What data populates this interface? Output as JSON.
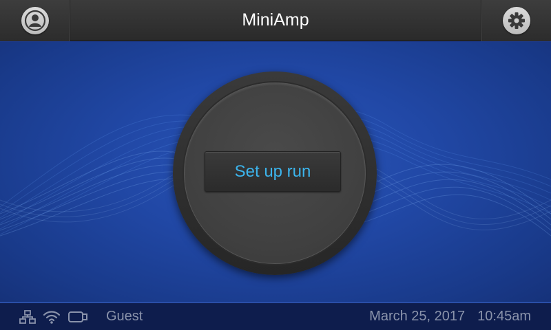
{
  "header": {
    "title": "MiniAmp",
    "left_icon": "user-profile-icon",
    "right_icon": "gear-icon"
  },
  "main": {
    "setup_button_label": "Set up run",
    "accent_color": "#3cb4ec"
  },
  "status_bar": {
    "icons": [
      "network-icon",
      "wifi-icon",
      "usb-drive-icon"
    ],
    "user": "Guest",
    "date": "March 25, 2017",
    "time": "10:45am"
  }
}
